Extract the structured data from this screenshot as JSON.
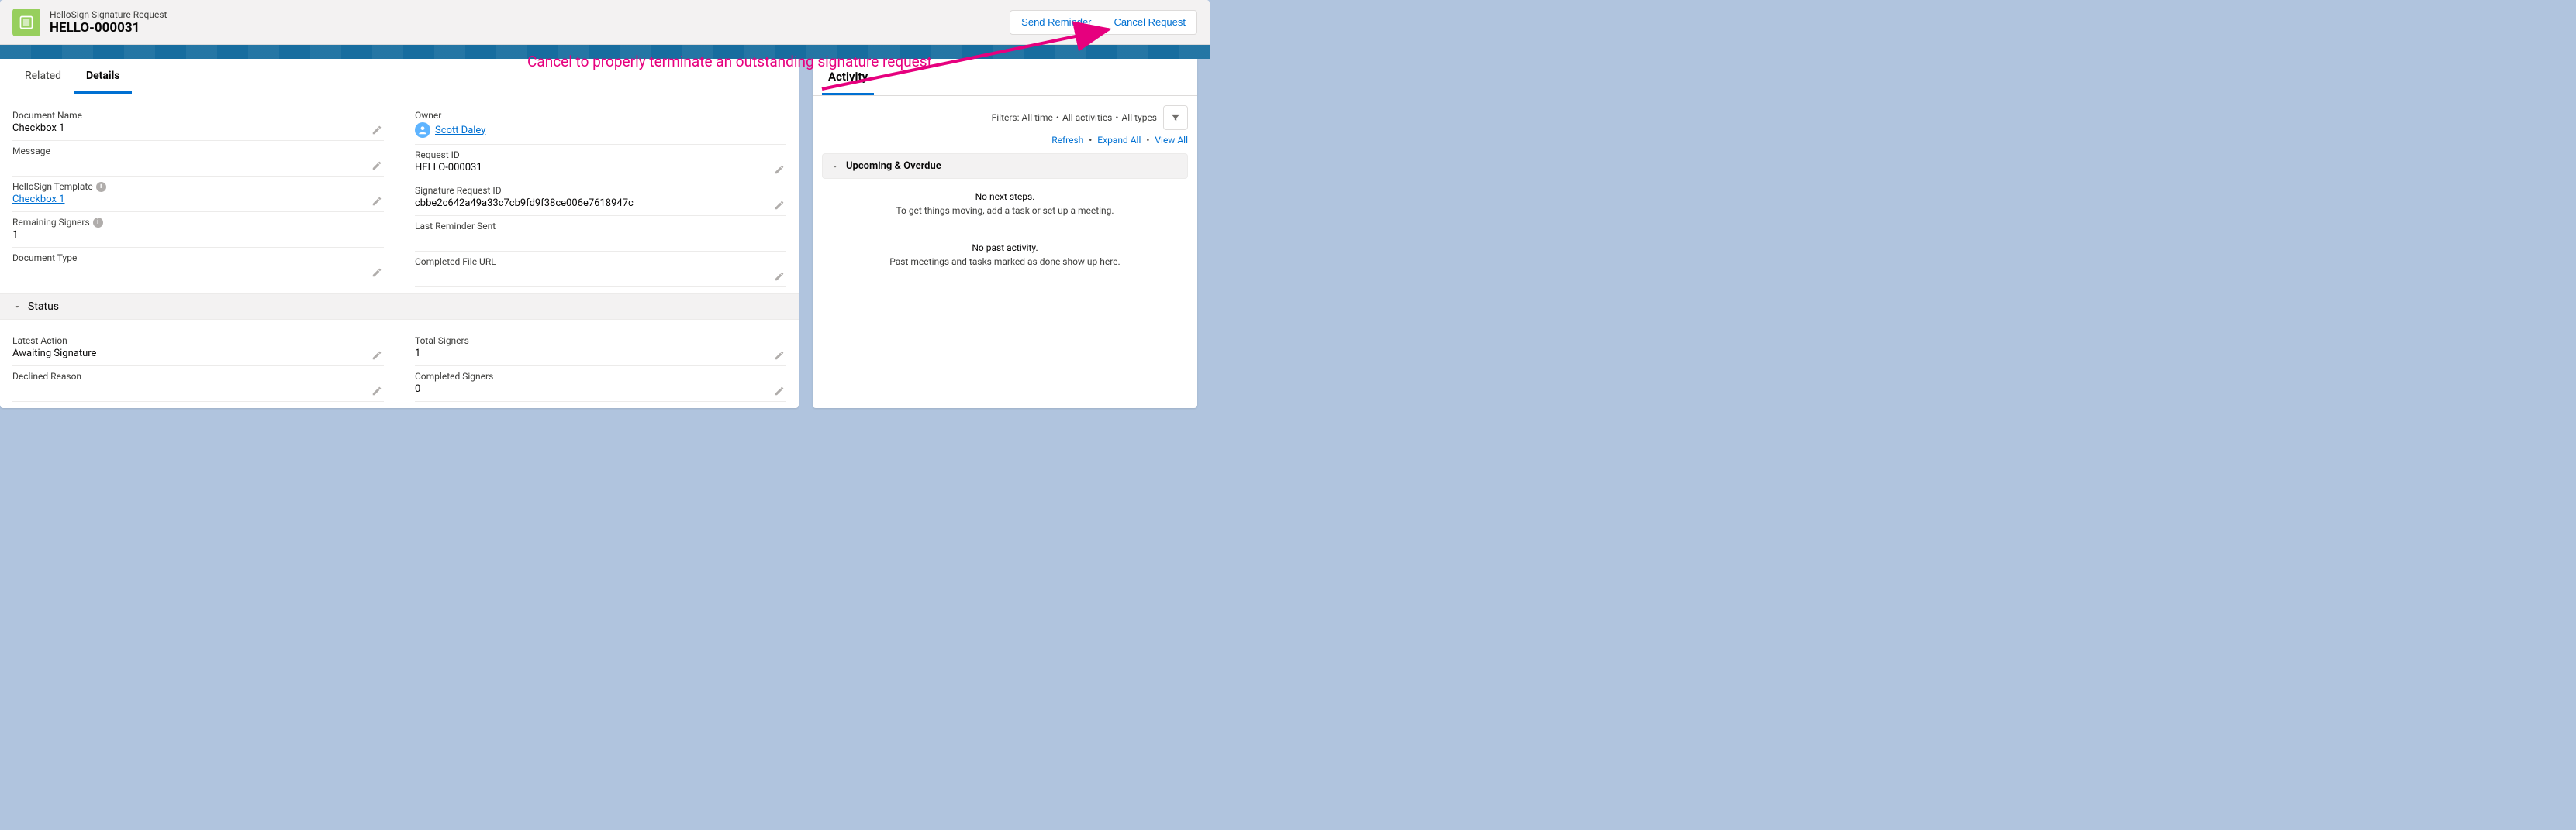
{
  "header": {
    "subtitle": "HelloSign Signature Request",
    "title": "HELLO-000031",
    "buttons": {
      "send_reminder": "Send Reminder",
      "cancel_request": "Cancel Request"
    }
  },
  "tabs": {
    "related": "Related",
    "details": "Details"
  },
  "fields": {
    "document_name": {
      "label": "Document Name",
      "value": "Checkbox 1"
    },
    "message": {
      "label": "Message",
      "value": ""
    },
    "hellosign_template": {
      "label": "HelloSign Template",
      "value": "Checkbox 1"
    },
    "remaining_signers": {
      "label": "Remaining Signers",
      "value": "1"
    },
    "document_type": {
      "label": "Document Type",
      "value": ""
    },
    "owner": {
      "label": "Owner",
      "value": "Scott Daley"
    },
    "request_id": {
      "label": "Request ID",
      "value": "HELLO-000031"
    },
    "signature_request_id": {
      "label": "Signature Request ID",
      "value": "cbbe2c642a49a33c7cb9fd9f38ce006e7618947c"
    },
    "last_reminder_sent": {
      "label": "Last Reminder Sent",
      "value": ""
    },
    "completed_file_url": {
      "label": "Completed File URL",
      "value": ""
    }
  },
  "status_section": {
    "title": "Status"
  },
  "status_fields": {
    "latest_action": {
      "label": "Latest Action",
      "value": "Awaiting Signature"
    },
    "declined_reason": {
      "label": "Declined Reason",
      "value": ""
    },
    "total_signers": {
      "label": "Total Signers",
      "value": "1"
    },
    "completed_signers": {
      "label": "Completed Signers",
      "value": "0"
    }
  },
  "activity": {
    "tab": "Activity",
    "filters": {
      "prefix": "Filters:",
      "time": "All time",
      "activities": "All activities",
      "types": "All types"
    },
    "links": {
      "refresh": "Refresh",
      "expand_all": "Expand All",
      "view_all": "View All"
    },
    "section_title": "Upcoming & Overdue",
    "no_next_title": "No next steps.",
    "no_next_sub": "To get things moving, add a task or set up a meeting.",
    "no_past_title": "No past activity.",
    "no_past_sub": "Past meetings and tasks marked as done show up here."
  },
  "annotation": {
    "text": "Cancel to properly terminate an outstanding signature request"
  }
}
